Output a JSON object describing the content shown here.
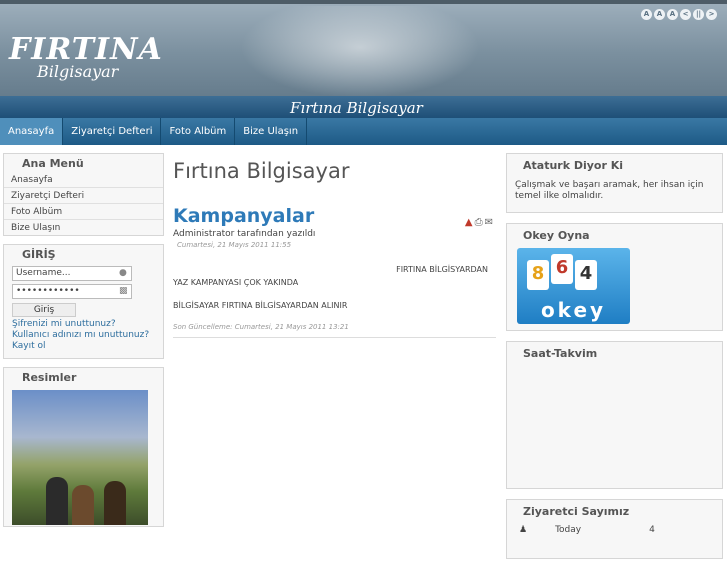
{
  "header": {
    "logo_main": "FIRTINA",
    "logo_sub": "Bilgisayar",
    "title": "Fırtına Bilgisayar",
    "tools": [
      "A",
      "A",
      "A",
      "<",
      "||",
      ">"
    ]
  },
  "nav": [
    "Anasayfa",
    "Ziyaretçi Defteri",
    "Foto Albüm",
    "Bize Ulaşın"
  ],
  "sidebar": {
    "menu_title": "Ana Menü",
    "menu": [
      "Anasayfa",
      "Ziyaretçi Defteri",
      "Foto Albüm",
      "Bize Ulaşın"
    ],
    "login_title": "GİRİŞ",
    "username_placeholder": "Username...",
    "password_value": "••••••••••••",
    "login_button": "Giriş",
    "links": [
      "Şifrenizi mi unuttunuz?",
      "Kullanıcı adınızı mı unuttunuz?",
      "Kayıt ol"
    ],
    "images_title": "Resimler"
  },
  "main": {
    "page_title": "Fırtına Bilgisayar",
    "article": {
      "title": "Kampanyalar",
      "author": "Administrator tarafından yazıldı",
      "date": "Cumartesi, 21 Mayıs 2011 11:55",
      "line1": "FIRTINA BİLGİSYARDAN",
      "line2": "YAZ  KAMPANYASI ÇOK YAKINDA",
      "line3": "BİLGİSAYAR   FIRTINA  BİLGİSAYARDAN  ALINIR",
      "modified": "Son Güncelleme: Cumartesi, 21 Mayıs 2011 13:21"
    }
  },
  "right": {
    "quote_title": "Ataturk Diyor Ki",
    "quote": "Çalışmak ve başarı aramak, her ihsan için temel ilke olmalıdır.",
    "okey_title": "Okey Oyna",
    "okey_tiles": [
      "8",
      "6",
      "4"
    ],
    "okey_word": "okey",
    "clock_title": "Saat-Takvim",
    "counter_title": "Ziyaretci Sayımız",
    "counter_label": "Today",
    "counter_value": "4"
  }
}
